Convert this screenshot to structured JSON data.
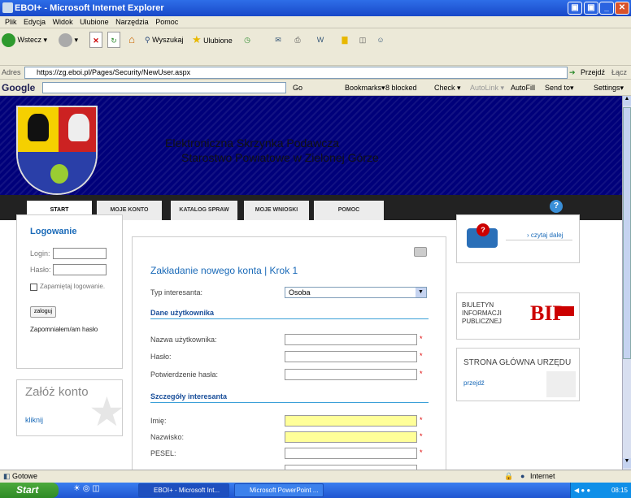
{
  "window": {
    "title": "EBOI+ - Microsoft Internet Explorer",
    "min": "_",
    "max": "▣",
    "close": "✕"
  },
  "menu": [
    "Plik",
    "Edycja",
    "Widok",
    "Ulubione",
    "Narzędzia",
    "Pomoc"
  ],
  "toolbar": {
    "back": "Wstecz",
    "search": "Wyszukaj",
    "favorites": "Ulubione"
  },
  "address": {
    "label": "Adres",
    "url": "https://zg.eboi.pl/Pages/Security/NewUser.aspx",
    "go": "Przejdź",
    "links": "Łącz"
  },
  "google_bar": {
    "logo": "Google",
    "go": "Go",
    "bookmarks": "Bookmarks▾",
    "blocked": "8 blocked",
    "check": "Check ▾",
    "autolink": "AutoLink ▾",
    "autofill": "AutoFill",
    "sendto": "Send to▾",
    "settings": "Settings▾"
  },
  "site": {
    "title_line1": "Elektroniczna Skrzynka Podawcza",
    "title_line2": "Starostwo Powiatowe w Zielonej Górze"
  },
  "nav": [
    {
      "label": "START"
    },
    {
      "label": "MOJE KONTO"
    },
    {
      "label": "KATALOG SPRAW"
    },
    {
      "label": "MOJE WNIOSKI"
    },
    {
      "label": "POMOC"
    }
  ],
  "help_icon": "?",
  "login": {
    "title": "Logowanie",
    "login_label": "Login:",
    "password_label": "Hasło:",
    "remember": "Zapamiętaj logowanie.",
    "submit": "zaloguj",
    "forgot": "Zapomniałem/am hasło"
  },
  "zaloz": {
    "title": "Załóż konto",
    "link": "kliknij"
  },
  "form": {
    "title": "Zakładanie nowego konta | Krok 1",
    "typ_label": "Typ interesanta:",
    "typ_value": "Osoba",
    "section_user": "Dane użytkownika",
    "username": "Nazwa użytkownika:",
    "password": "Hasło:",
    "password2": "Potwierdzenie hasła:",
    "section_details": "Szczegóły interesanta",
    "first_name": "Imię:",
    "last_name": "Nazwisko:",
    "pesel": "PESEL:",
    "required": "*"
  },
  "right": {
    "read_more": "› czytaj dalej",
    "bip_lines": [
      "BIULETYN",
      "INFORMACJI",
      "PUBLICZNEJ"
    ],
    "bip_logo": "BIP",
    "home_title": "STRONA GŁÓWNA URZĘDU",
    "home_link": "przejdź"
  },
  "status": {
    "text": "Gotowe",
    "zone": "Internet"
  },
  "taskbar": {
    "start": "Start",
    "tasks": [
      "EBOI+ - Microsoft Int...",
      "Microsoft PowerPoint ..."
    ],
    "clock": "08:15"
  }
}
